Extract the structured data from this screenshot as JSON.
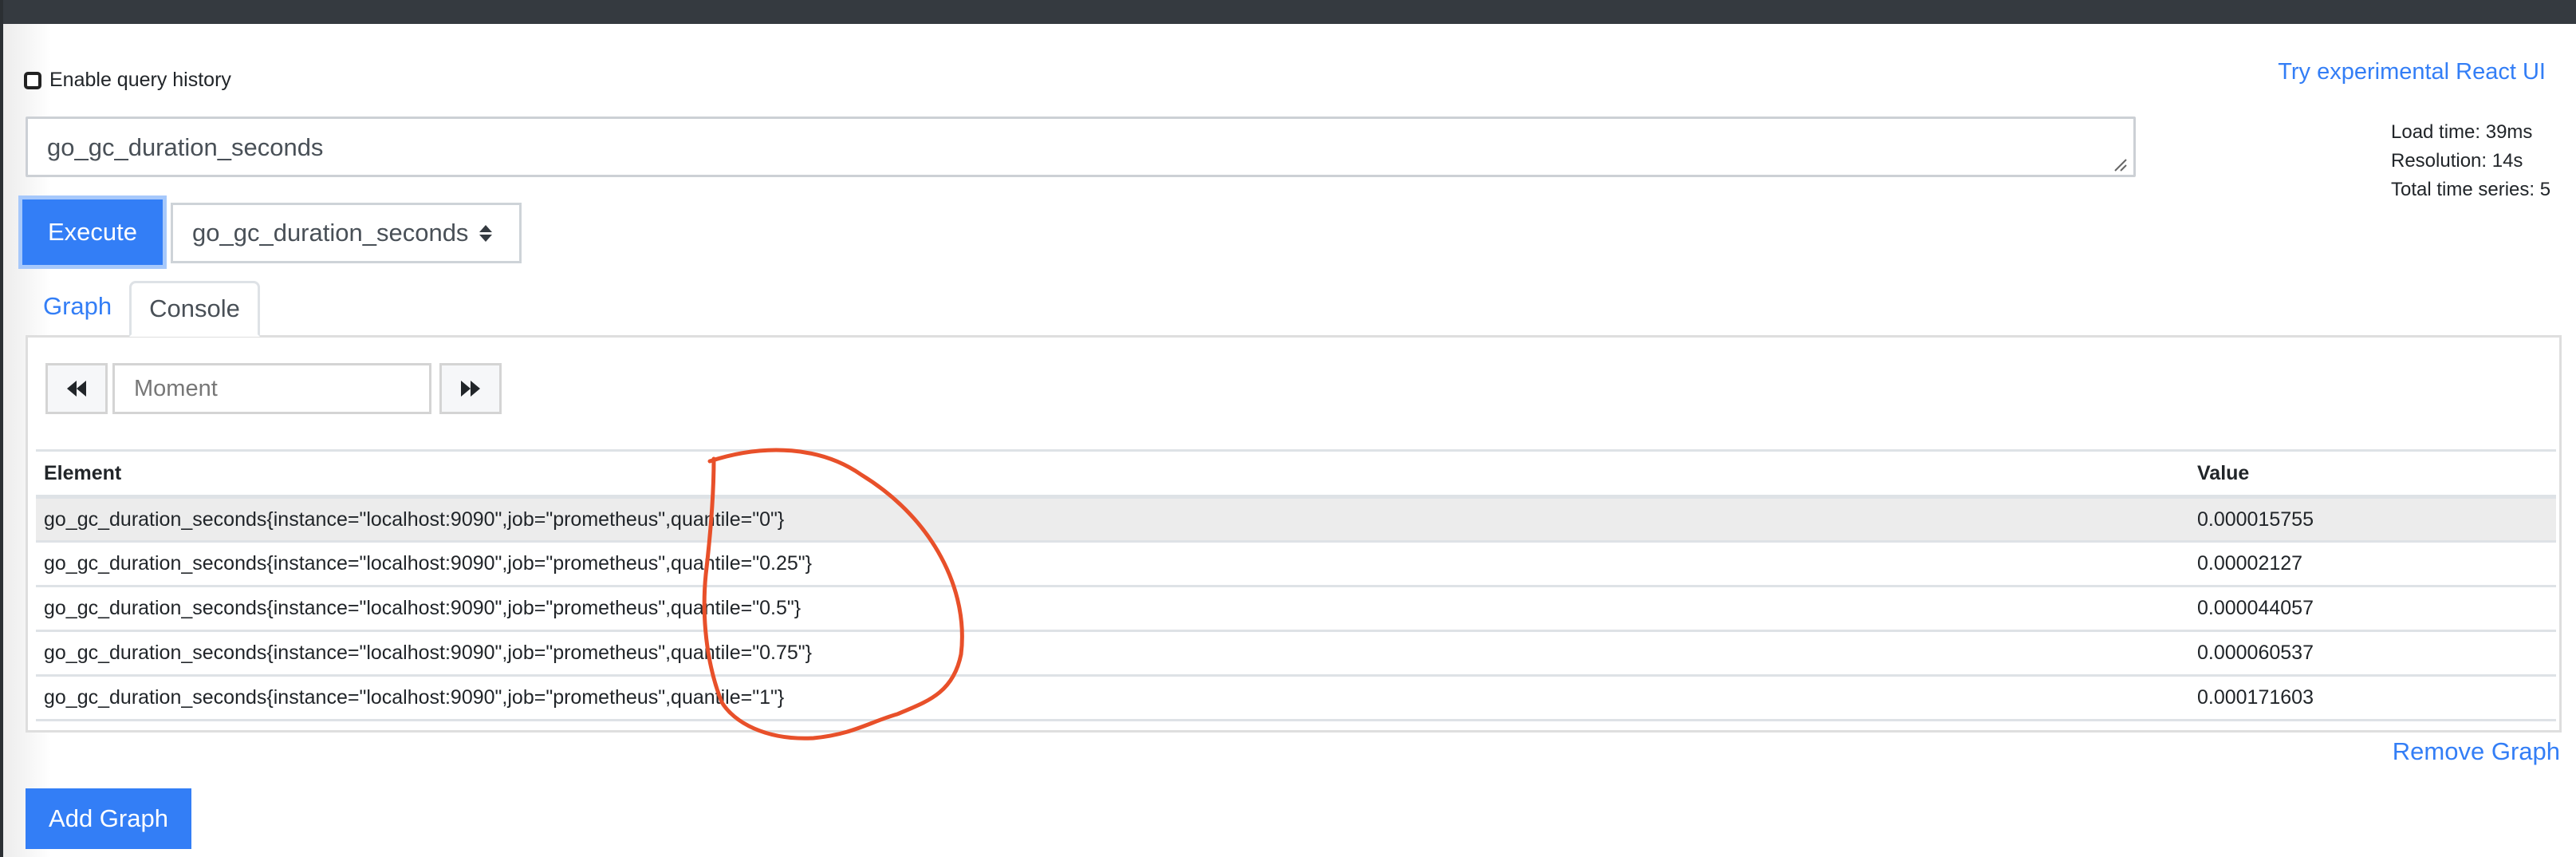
{
  "header": {},
  "query_history": {
    "label": "Enable query history",
    "checked": false
  },
  "react_link": "Try experimental React UI",
  "query": {
    "value": "go_gc_duration_seconds"
  },
  "stats": {
    "load_time": "Load time: 39ms",
    "resolution": "Resolution: 14s",
    "total_series": "Total time series: 5"
  },
  "execute_label": "Execute",
  "metric_select": {
    "selected": "go_gc_duration_seconds"
  },
  "tabs": [
    {
      "label": "Graph",
      "active": false
    },
    {
      "label": "Console",
      "active": true
    }
  ],
  "console": {
    "moment_placeholder": "Moment",
    "back_icon": "fast-backward-icon",
    "forward_icon": "fast-forward-icon",
    "columns": [
      "Element",
      "Value"
    ],
    "rows": [
      {
        "element": "go_gc_duration_seconds{instance=\"localhost:9090\",job=\"prometheus\",quantile=\"0\"}",
        "value": "0.000015755"
      },
      {
        "element": "go_gc_duration_seconds{instance=\"localhost:9090\",job=\"prometheus\",quantile=\"0.25\"}",
        "value": "0.00002127"
      },
      {
        "element": "go_gc_duration_seconds{instance=\"localhost:9090\",job=\"prometheus\",quantile=\"0.5\"}",
        "value": "0.000044057"
      },
      {
        "element": "go_gc_duration_seconds{instance=\"localhost:9090\",job=\"prometheus\",quantile=\"0.75\"}",
        "value": "0.000060537"
      },
      {
        "element": "go_gc_duration_seconds{instance=\"localhost:9090\",job=\"prometheus\",quantile=\"1\"}",
        "value": "0.000171603"
      }
    ]
  },
  "remove_graph_label": "Remove Graph",
  "add_graph_label": "Add Graph",
  "colors": {
    "accent": "#337ef6",
    "annotation": "#e8502a",
    "topbar": "#353a40"
  }
}
